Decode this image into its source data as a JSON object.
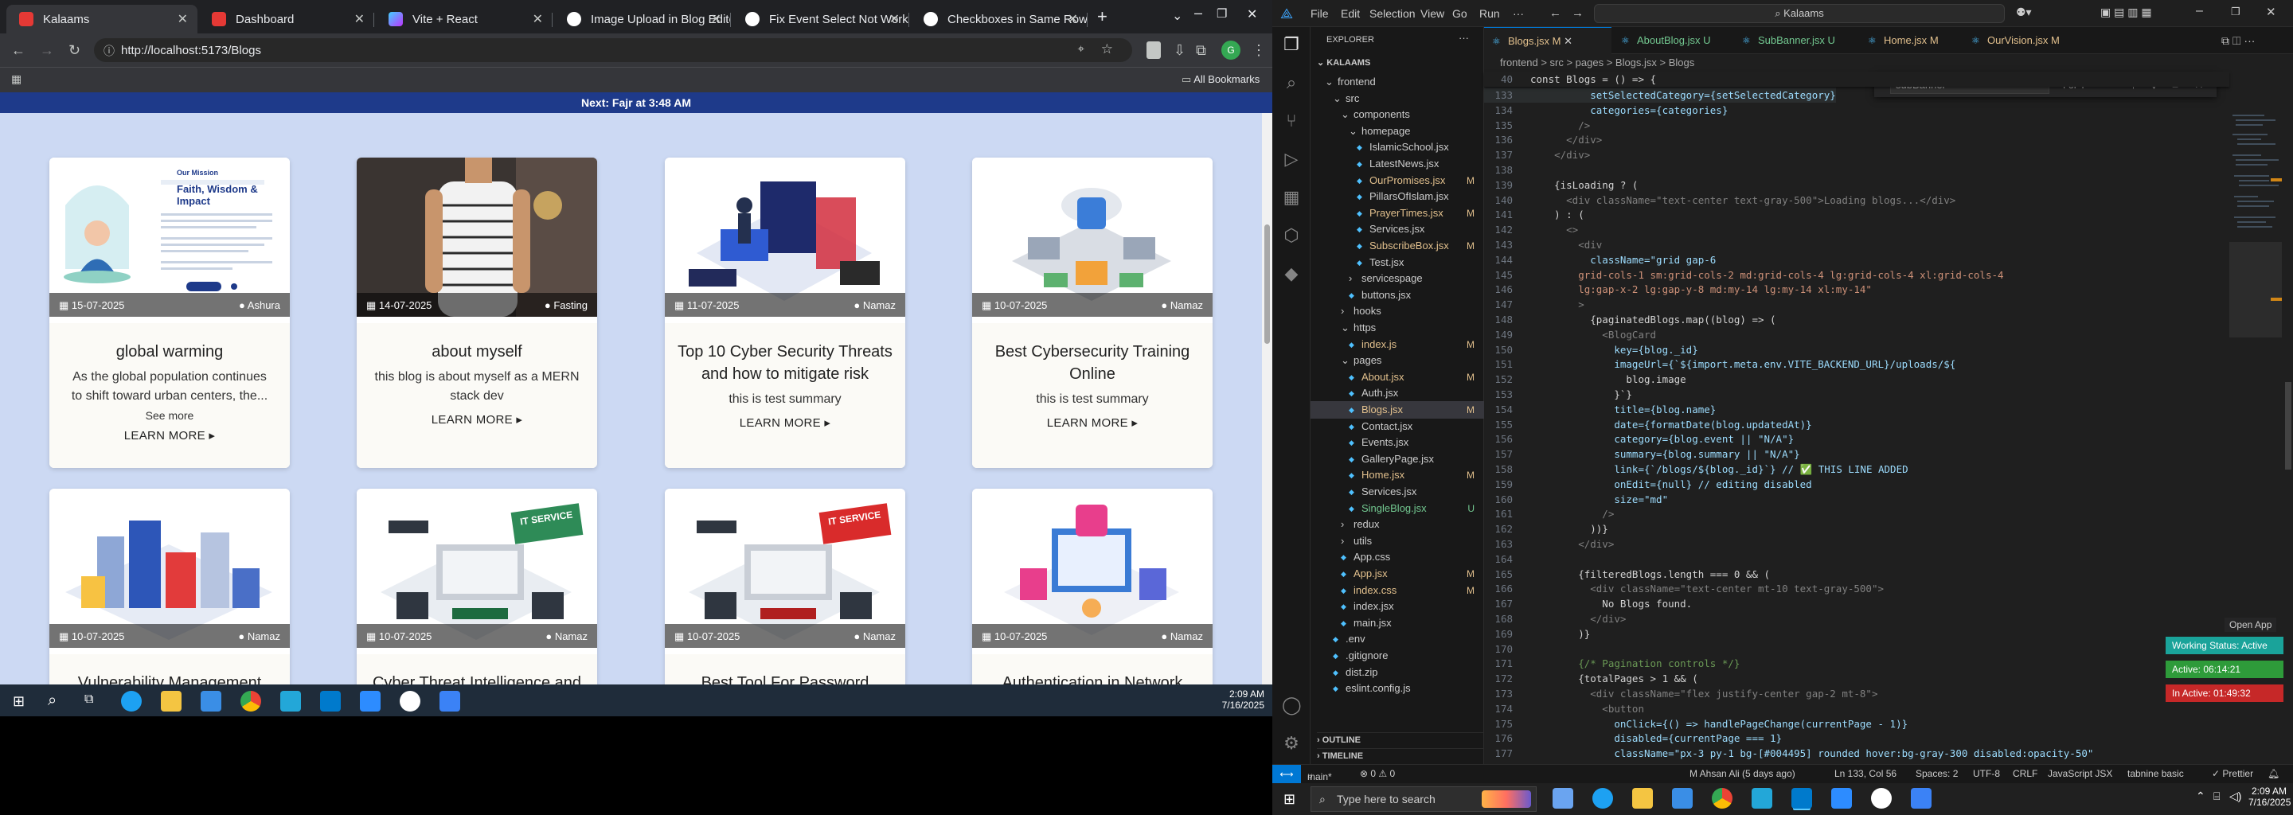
{
  "browser": {
    "tabs": [
      {
        "title": "Kalaams",
        "active": true
      },
      {
        "title": "Dashboard",
        "active": false
      },
      {
        "title": "Vite + React",
        "active": false
      },
      {
        "title": "Image Upload in Blog Editor",
        "active": false
      },
      {
        "title": "Fix Event Select Not Working",
        "active": false
      },
      {
        "title": "Checkboxes in Same Row",
        "active": false
      }
    ],
    "new_tab_label": "+",
    "url": "http://localhost:5173/Blogs",
    "bookmarks_label": "All Bookmarks"
  },
  "site": {
    "prayer_banner": "Next: Fajr at 3:48 AM",
    "cards": [
      {
        "title": "global warming",
        "date": "15-07-2025",
        "category": "Ashura",
        "summary": "As the global population continues to shift toward urban centers, the...",
        "see_more": "See more",
        "learn_more": "LEARN MORE ▸",
        "image_text_title": "Faith, Wisdom & Impact",
        "image_text_small": "Our Mission"
      },
      {
        "title": "about myself",
        "date": "14-07-2025",
        "category": "Fasting",
        "summary": "this blog is about myself as a MERN stack dev",
        "see_more": "",
        "learn_more": "LEARN MORE ▸"
      },
      {
        "title": "Top 10 Cyber Security Threats and how to mitigate risk",
        "date": "11-07-2025",
        "category": "Namaz",
        "summary": "this is test summary",
        "see_more": "",
        "learn_more": "LEARN MORE ▸"
      },
      {
        "title": "Best Cybersecurity Training Online",
        "date": "10-07-2025",
        "category": "Namaz",
        "summary": "this is test summary",
        "see_more": "",
        "learn_more": "LEARN MORE ▸"
      },
      {
        "title": "Vulnerability Management",
        "date": "10-07-2025",
        "category": "Namaz",
        "summary": "",
        "see_more": "",
        "learn_more": ""
      },
      {
        "title": "Cyber Threat Intelligence and",
        "date": "10-07-2025",
        "category": "Namaz",
        "summary": "",
        "see_more": "",
        "learn_more": "",
        "image_text": "IT SERVICE"
      },
      {
        "title": "Best Tool For Password",
        "date": "10-07-2025",
        "category": "Namaz",
        "summary": "",
        "see_more": "",
        "learn_more": "",
        "image_text": "IT SERVICE"
      },
      {
        "title": "Authentication in Network",
        "date": "10-07-2025",
        "category": "Namaz",
        "summary": "",
        "see_more": "",
        "learn_more": ""
      }
    ]
  },
  "left_taskbar": {
    "time": "2:09 AM",
    "date": "7/16/2025"
  },
  "vscode": {
    "menu": [
      "File",
      "Edit",
      "Selection",
      "View",
      "Go",
      "Run",
      "···"
    ],
    "search": "Kalaams",
    "explorer_title": "EXPLORER",
    "root": "KALAAMS",
    "tree": [
      {
        "name": "frontend",
        "indent": 1,
        "kind": "folder-open",
        "status": ""
      },
      {
        "name": "src",
        "indent": 2,
        "kind": "folder-open",
        "status": ""
      },
      {
        "name": "components",
        "indent": 3,
        "kind": "folder-open",
        "status": ""
      },
      {
        "name": "homepage",
        "indent": 4,
        "kind": "folder-open",
        "status": ""
      },
      {
        "name": "IslamicSchool.jsx",
        "indent": 5,
        "kind": "file",
        "status": ""
      },
      {
        "name": "LatestNews.jsx",
        "indent": 5,
        "kind": "file",
        "status": ""
      },
      {
        "name": "OurPromises.jsx",
        "indent": 5,
        "kind": "file",
        "status": "M"
      },
      {
        "name": "PillarsOfIslam.jsx",
        "indent": 5,
        "kind": "file",
        "status": ""
      },
      {
        "name": "PrayerTimes.jsx",
        "indent": 5,
        "kind": "file",
        "status": "M"
      },
      {
        "name": "Services.jsx",
        "indent": 5,
        "kind": "file",
        "status": ""
      },
      {
        "name": "SubscribeBox.jsx",
        "indent": 5,
        "kind": "file",
        "status": "M"
      },
      {
        "name": "Test.jsx",
        "indent": 5,
        "kind": "file",
        "status": ""
      },
      {
        "name": "servicespage",
        "indent": 4,
        "kind": "folder",
        "status": ""
      },
      {
        "name": "buttons.jsx",
        "indent": 4,
        "kind": "file",
        "status": ""
      },
      {
        "name": "hooks",
        "indent": 3,
        "kind": "folder",
        "status": ""
      },
      {
        "name": "https",
        "indent": 3,
        "kind": "folder-open",
        "status": ""
      },
      {
        "name": "index.js",
        "indent": 4,
        "kind": "file",
        "status": "M"
      },
      {
        "name": "pages",
        "indent": 3,
        "kind": "folder-open",
        "status": ""
      },
      {
        "name": "About.jsx",
        "indent": 4,
        "kind": "file",
        "status": "M"
      },
      {
        "name": "Auth.jsx",
        "indent": 4,
        "kind": "file",
        "status": ""
      },
      {
        "name": "Blogs.jsx",
        "indent": 4,
        "kind": "file",
        "status": "M",
        "selected": true
      },
      {
        "name": "Contact.jsx",
        "indent": 4,
        "kind": "file",
        "status": ""
      },
      {
        "name": "Events.jsx",
        "indent": 4,
        "kind": "file",
        "status": ""
      },
      {
        "name": "GalleryPage.jsx",
        "indent": 4,
        "kind": "file",
        "status": ""
      },
      {
        "name": "Home.jsx",
        "indent": 4,
        "kind": "file",
        "status": "M"
      },
      {
        "name": "Services.jsx",
        "indent": 4,
        "kind": "file",
        "status": ""
      },
      {
        "name": "SingleBlog.jsx",
        "indent": 4,
        "kind": "file",
        "status": "U"
      },
      {
        "name": "redux",
        "indent": 3,
        "kind": "folder",
        "status": ""
      },
      {
        "name": "utils",
        "indent": 3,
        "kind": "folder",
        "status": ""
      },
      {
        "name": "App.css",
        "indent": 3,
        "kind": "file",
        "status": ""
      },
      {
        "name": "App.jsx",
        "indent": 3,
        "kind": "file",
        "status": "M"
      },
      {
        "name": "index.css",
        "indent": 3,
        "kind": "file",
        "status": "M"
      },
      {
        "name": "index.jsx",
        "indent": 3,
        "kind": "file",
        "status": ""
      },
      {
        "name": "main.jsx",
        "indent": 3,
        "kind": "file",
        "status": ""
      },
      {
        "name": ".env",
        "indent": 2,
        "kind": "file",
        "status": ""
      },
      {
        "name": ".gitignore",
        "indent": 2,
        "kind": "file",
        "status": ""
      },
      {
        "name": "dist.zip",
        "indent": 2,
        "kind": "file",
        "status": ""
      },
      {
        "name": "eslint.config.js",
        "indent": 2,
        "kind": "file",
        "status": ""
      }
    ],
    "outline_label": "OUTLINE",
    "timeline_label": "TIMELINE",
    "editor_tabs": [
      {
        "label": "Blogs.jsx",
        "status": "M",
        "active": true
      },
      {
        "label": "AboutBlog.jsx",
        "status": "U",
        "active": false
      },
      {
        "label": "SubBanner.jsx",
        "status": "U",
        "active": false
      },
      {
        "label": "Home.jsx",
        "status": "M",
        "active": false
      },
      {
        "label": "OurVision.jsx",
        "status": "M",
        "active": false
      }
    ],
    "breadcrumb": "frontend > src > pages > Blogs.jsx > Blogs",
    "find": {
      "query": "subBanner",
      "result": "4 of 4",
      "options": "Aa  ab  .*"
    },
    "sticky_line": {
      "num": "40",
      "text": "const Blogs = () => {"
    },
    "code": [
      {
        "num": "133",
        "html": "          setSelectedCategory={setSelectedCategory}"
      },
      {
        "num": "134",
        "html": "          categories={categories}"
      },
      {
        "num": "135",
        "html": "        />"
      },
      {
        "num": "136",
        "html": "      </div>"
      },
      {
        "num": "137",
        "html": "    </div>"
      },
      {
        "num": "138",
        "html": ""
      },
      {
        "num": "139",
        "html": "    {isLoading ? ("
      },
      {
        "num": "140",
        "html": "      <div className=\"text-center text-gray-500\">Loading blogs...</div>"
      },
      {
        "num": "141",
        "html": "    ) : ("
      },
      {
        "num": "142",
        "html": "      <>"
      },
      {
        "num": "143",
        "html": "        <div"
      },
      {
        "num": "144",
        "html": "          className=\"grid gap-6"
      },
      {
        "num": "145",
        "html": "        grid-cols-1 sm:grid-cols-2 md:grid-cols-4 lg:grid-cols-4 xl:grid-cols-4"
      },
      {
        "num": "146",
        "html": "        lg:gap-x-2 lg:gap-y-8 md:my-14 lg:my-14 xl:my-14\""
      },
      {
        "num": "147",
        "html": "        >"
      },
      {
        "num": "148",
        "html": "          {paginatedBlogs.map((blog) => ("
      },
      {
        "num": "149",
        "html": "            <BlogCard"
      },
      {
        "num": "150",
        "html": "              key={blog._id}"
      },
      {
        "num": "151",
        "html": "              imageUrl={`${import.meta.env.VITE_BACKEND_URL}/uploads/${"
      },
      {
        "num": "152",
        "html": "                blog.image"
      },
      {
        "num": "153",
        "html": "              }`}"
      },
      {
        "num": "154",
        "html": "              title={blog.name}"
      },
      {
        "num": "155",
        "html": "              date={formatDate(blog.updatedAt)}"
      },
      {
        "num": "156",
        "html": "              category={blog.event || \"N/A\"}"
      },
      {
        "num": "157",
        "html": "              summary={blog.summary || \"N/A\"}"
      },
      {
        "num": "158",
        "html": "              link={`/blogs/${blog._id}`} // ✅ THIS LINE ADDED"
      },
      {
        "num": "159",
        "html": "              onEdit={null} // editing disabled"
      },
      {
        "num": "160",
        "html": "              size=\"md\""
      },
      {
        "num": "161",
        "html": "            />"
      },
      {
        "num": "162",
        "html": "          ))}"
      },
      {
        "num": "163",
        "html": "        </div>"
      },
      {
        "num": "164",
        "html": ""
      },
      {
        "num": "165",
        "html": "        {filteredBlogs.length === 0 && ("
      },
      {
        "num": "166",
        "html": "          <div className=\"text-center mt-10 text-gray-500\">"
      },
      {
        "num": "167",
        "html": "            No Blogs found."
      },
      {
        "num": "168",
        "html": "          </div>"
      },
      {
        "num": "169",
        "html": "        )}"
      },
      {
        "num": "170",
        "html": ""
      },
      {
        "num": "171",
        "html": "        {/* Pagination controls */}"
      },
      {
        "num": "172",
        "html": "        {totalPages > 1 && ("
      },
      {
        "num": "173",
        "html": "          <div className=\"flex justify-center gap-2 mt-8\">"
      },
      {
        "num": "174",
        "html": "            <button"
      },
      {
        "num": "175",
        "html": "              onClick={() => handlePageChange(currentPage - 1)}"
      },
      {
        "num": "176",
        "html": "              disabled={currentPage === 1}"
      },
      {
        "num": "177",
        "html": "              className=\"px-3 py-1 bg-[#004495] rounded hover:bg-gray-300 disabled:opacity-50\""
      }
    ],
    "open_app": "Open App",
    "status": {
      "branch": "main*",
      "problems": "⊗ 0 ⚠ 0",
      "blame": "M Ahsan Ali (5 days ago)",
      "position": "Ln 133, Col 56",
      "spaces": "Spaces: 2",
      "encoding": "UTF-8",
      "eol": "CRLF",
      "lang": "JavaScript JSX",
      "tabnine": "tabnine basic",
      "prettier": "✓ Prettier"
    },
    "working_status": [
      {
        "text": "Working Status: Active",
        "color": "#1aa39a"
      },
      {
        "text": "Active: 06:14:21",
        "color": "#2e9b3a"
      },
      {
        "text": "In Active: 01:49:32",
        "color": "#c62828"
      }
    ]
  },
  "windows_taskbar": {
    "search_placeholder": "Type here to search",
    "time": "2:09 AM",
    "date": "7/16/2025"
  }
}
